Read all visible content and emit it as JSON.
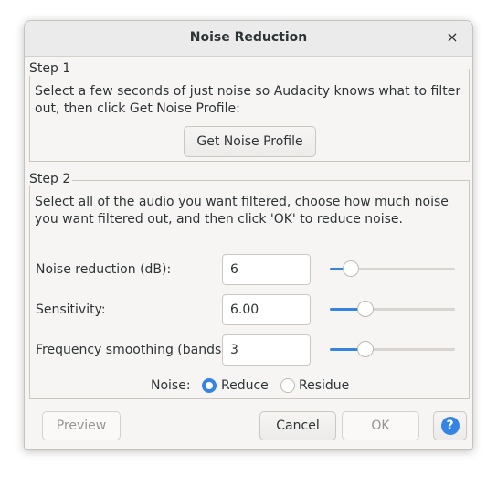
{
  "window": {
    "title": "Noise Reduction",
    "close_glyph": "×"
  },
  "step1": {
    "legend": "Step 1",
    "description": "Select a few seconds of just noise so Audacity knows what to filter out, then click Get Noise Profile:",
    "button_label": "Get Noise Profile"
  },
  "step2": {
    "legend": "Step 2",
    "description": "Select all of the audio you want filtered, choose how much noise you want filtered out, and then click 'OK' to reduce noise.",
    "params": [
      {
        "label": "Noise reduction (dB):",
        "value": "6",
        "slider_fraction": 0.12
      },
      {
        "label": "Sensitivity:",
        "value": "6.00",
        "slider_fraction": 0.25
      },
      {
        "label": "Frequency smoothing (bands):",
        "value": "3",
        "slider_fraction": 0.25
      }
    ],
    "noise_label": "Noise:",
    "noise_options": [
      {
        "label": "Reduce",
        "selected": true
      },
      {
        "label": "Residue",
        "selected": false
      }
    ]
  },
  "footer": {
    "preview_label": "Preview",
    "cancel_label": "Cancel",
    "ok_label": "OK",
    "help_glyph": "?"
  },
  "colors": {
    "accent": "#3584e4",
    "help_icon": "#3584e4"
  },
  "icons": {
    "close": "close-icon",
    "help": "help-icon"
  }
}
